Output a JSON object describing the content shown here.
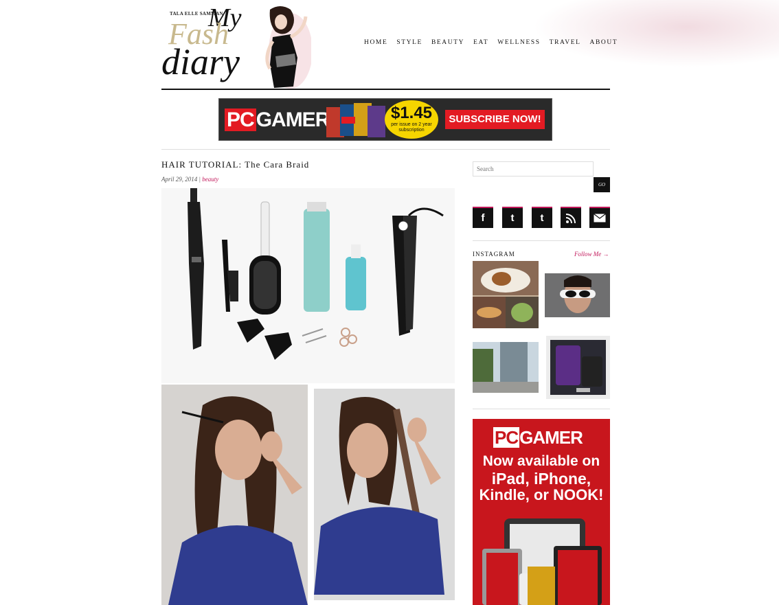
{
  "site": {
    "byline": "TALA ELLE SAMMAN",
    "logo_line1": "My",
    "logo_line2": "Fash",
    "logo_line3": "diary"
  },
  "nav": [
    "HOME",
    "STYLE",
    "BEAUTY",
    "EAT",
    "WELLNESS",
    "TRAVEL",
    "ABOUT"
  ],
  "banner_ad": {
    "brand_pc": "PC",
    "brand_gamer": "GAMER",
    "price": "$1.45",
    "price_note": "per issue on 2 year subscription",
    "cta": "SUBSCRIBE NOW!"
  },
  "post": {
    "title": "HAIR TUTORIAL: The Cara Braid",
    "date": "April 29, 2014",
    "separator": " | ",
    "category": "beauty"
  },
  "sidebar": {
    "search_placeholder": "Search",
    "go_label": "GO",
    "social_icons": [
      "facebook-icon",
      "twitter-icon",
      "tumblr-icon",
      "rss-icon",
      "email-icon"
    ],
    "instagram_title": "INSTAGRAM",
    "instagram_follow": "Follow Me →"
  },
  "side_ad": {
    "brand_pc": "PC",
    "brand_gamer": "GAMER",
    "line1": "Now available on",
    "line2": "iPad, iPhone,",
    "line3": "Kindle, or NOOK!"
  },
  "colors": {
    "accent": "#c2185b",
    "ad_red": "#c8161d",
    "ad_yellow": "#f6d500"
  }
}
